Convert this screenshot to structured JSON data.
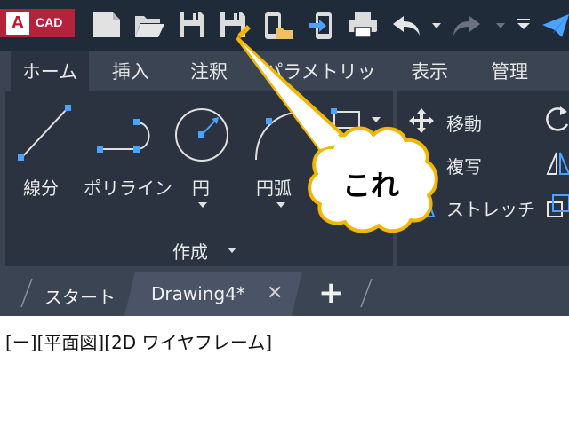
{
  "app": {
    "logo_letter": "A",
    "logo_text": "CAD"
  },
  "quick_access": [
    {
      "name": "new-icon"
    },
    {
      "name": "open-icon"
    },
    {
      "name": "save-icon"
    },
    {
      "name": "save-as-icon"
    },
    {
      "name": "open-from-web-icon"
    },
    {
      "name": "save-to-web-icon"
    },
    {
      "name": "print-icon"
    },
    {
      "name": "undo-icon"
    },
    {
      "name": "redo-icon"
    },
    {
      "name": "customize-icon"
    },
    {
      "name": "share-icon"
    }
  ],
  "ribbon_tabs": [
    {
      "label": "ホーム",
      "active": true
    },
    {
      "label": "挿入"
    },
    {
      "label": "注釈"
    },
    {
      "label": "パラメトリック"
    },
    {
      "label": "表示"
    },
    {
      "label": "管理"
    }
  ],
  "draw_panel": {
    "title": "作成",
    "tools": [
      {
        "label": "線分"
      },
      {
        "label": "ポリライン"
      },
      {
        "label": "円"
      },
      {
        "label": "円弧"
      }
    ]
  },
  "modify_panel": {
    "tools": [
      {
        "label": "移動"
      },
      {
        "label": "複写"
      },
      {
        "label": "ストレッチ"
      }
    ]
  },
  "file_tabs": {
    "start": "スタート",
    "doc": "Drawing4*",
    "close_symbol": "✕",
    "add_symbol": "+"
  },
  "viewport": {
    "label": "[ー][平面図][2D ワイヤフレーム]"
  },
  "callout": {
    "text": "これ"
  },
  "colors": {
    "toolbar_bg": "#202b3a",
    "ribbon_bg": "#3b4453",
    "panel_bg": "#2b3341",
    "accent_blue": "#4aa3ff",
    "callout_fill": "#ffffff",
    "callout_stroke": "#f2b705"
  }
}
